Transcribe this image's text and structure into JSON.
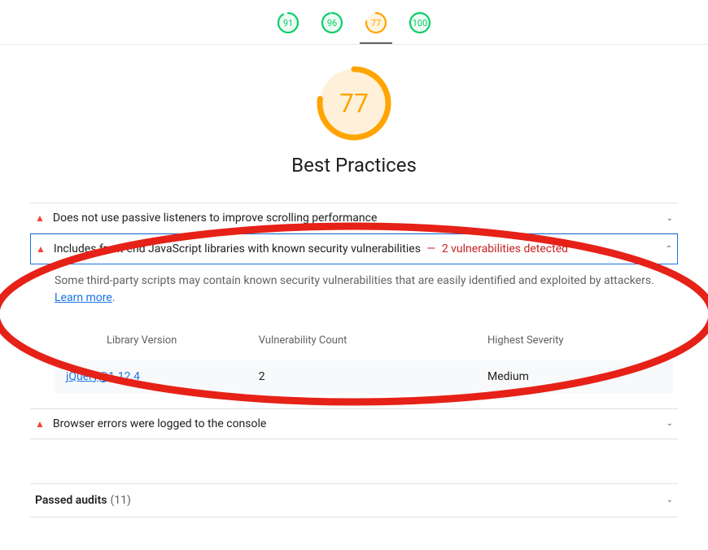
{
  "tabs": [
    {
      "score": 91,
      "color": "#0CCE6B",
      "bg": "rgba(12,206,107,0.08)"
    },
    {
      "score": 96,
      "color": "#0CCE6B",
      "bg": "rgba(12,206,107,0.08)"
    },
    {
      "score": 77,
      "color": "#FFA400",
      "bg": "rgba(255,164,0,0.12)"
    },
    {
      "score": 100,
      "color": "#0CCE6B",
      "bg": "rgba(12,206,107,0.08)"
    }
  ],
  "hero": {
    "score": 77,
    "title": "Best Practices",
    "color": "#FFA400",
    "bg": "rgba(255,164,0,0.15)"
  },
  "audits": {
    "passive": {
      "title": "Does not use passive listeners to improve scrolling performance"
    },
    "vuln": {
      "title": "Includes front-end JavaScript libraries with known security vulnerabilities",
      "suffix": "2 vulnerabilities detected",
      "desc": "Some third-party scripts may contain known security vulnerabilities that are easily identified and exploited by attackers. ",
      "learn": "Learn more"
    },
    "browser_errors": {
      "title": "Browser errors were logged to the console"
    }
  },
  "table": {
    "headers": {
      "library": "Library Version",
      "count": "Vulnerability Count",
      "severity": "Highest Severity"
    },
    "row": {
      "library": "jQuery@1.12.4",
      "count": "2",
      "severity": "Medium"
    }
  },
  "passed": {
    "title": "Passed audits",
    "count": "(11)"
  }
}
